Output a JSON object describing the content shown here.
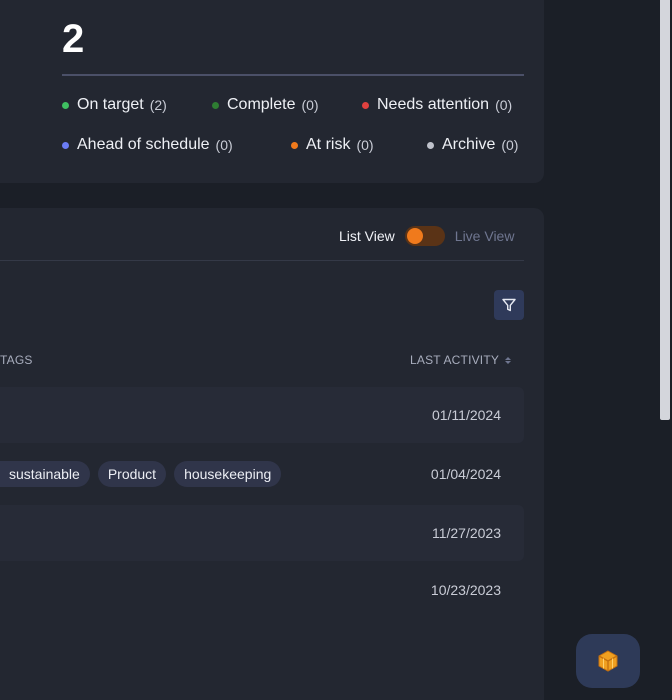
{
  "summary": {
    "total_count": "2",
    "statuses": [
      {
        "label": "On target",
        "count": "(2)",
        "color": "#3fbf61"
      },
      {
        "label": "Complete",
        "count": "(0)",
        "color": "#2e7d32"
      },
      {
        "label": "Needs attention",
        "count": "(0)",
        "color": "#e0413f"
      },
      {
        "label": "Ahead of schedule",
        "count": "(0)",
        "color": "#6b7cf5"
      },
      {
        "label": "At risk",
        "count": "(0)",
        "color": "#f07a1c"
      },
      {
        "label": "Archive",
        "count": "(0)",
        "color": "#bfc2cb"
      }
    ]
  },
  "view_toggle": {
    "list_label": "List View",
    "live_label": "Live View",
    "active": "List View",
    "accent": "#f07a1c"
  },
  "table": {
    "headers": {
      "tags": "TAGS",
      "last_activity": "LAST ACTIVITY"
    },
    "rows": [
      {
        "tags": [],
        "last_activity": "01/11/2024"
      },
      {
        "tags": [
          "sustainable",
          "Product",
          "housekeeping"
        ],
        "last_activity": "01/04/2024"
      },
      {
        "tags": [],
        "last_activity": "11/27/2023"
      },
      {
        "tags": [],
        "last_activity": "10/23/2023"
      }
    ]
  },
  "icons": {
    "filter": "filter-icon",
    "sort": "sort-icon",
    "fab": "cube-icon"
  }
}
